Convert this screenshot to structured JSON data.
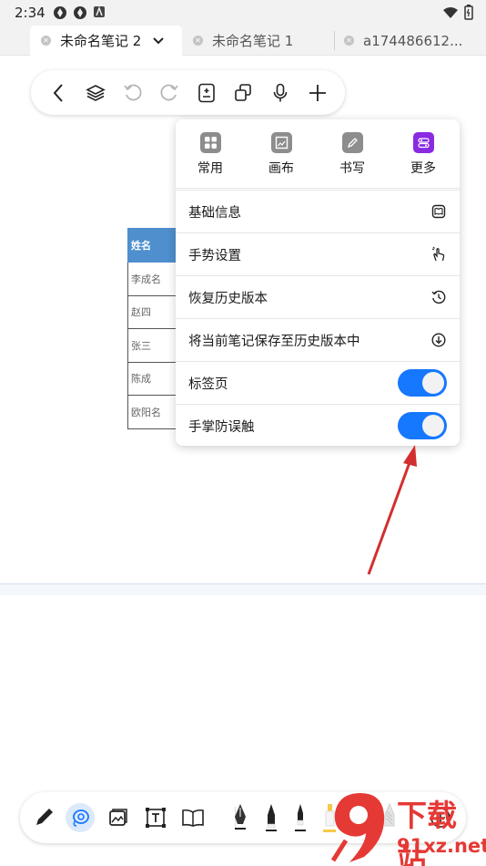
{
  "status_bar": {
    "time": "2:34"
  },
  "tabs": [
    {
      "label": "未命名笔记 2",
      "active": true
    },
    {
      "label": "未命名笔记 1",
      "active": false
    },
    {
      "label": "a174486612...",
      "active": false
    }
  ],
  "toolbar_icons": [
    "back-icon",
    "layers-icon",
    "undo-icon",
    "redo-icon",
    "page-add-icon",
    "copy-icon",
    "microphone-icon",
    "plus-icon"
  ],
  "table": {
    "header": "姓名",
    "rows": [
      "李成名",
      "赵四",
      "张三",
      "陈成",
      "欧阳名"
    ]
  },
  "menu": {
    "tabs": [
      {
        "label": "常用",
        "icon": "grid-icon"
      },
      {
        "label": "画布",
        "icon": "canvas-icon"
      },
      {
        "label": "书写",
        "icon": "pen-icon"
      },
      {
        "label": "更多",
        "icon": "more-settings-icon"
      }
    ],
    "items": [
      {
        "label": "基础信息",
        "icon": "book-icon"
      },
      {
        "label": "手势设置",
        "icon": "gesture-icon"
      },
      {
        "label": "恢复历史版本",
        "icon": "history-icon"
      },
      {
        "label": "将当前笔记保存至历史版本中",
        "icon": "download-circle-icon"
      },
      {
        "label": "标签页",
        "toggle": true
      },
      {
        "label": "手掌防误触",
        "toggle": true
      }
    ]
  },
  "colors": {
    "accent": "#1677ff",
    "arrow": "#d32f2f",
    "table_header": "#4f8fce",
    "more_icon": "#8a2be2"
  },
  "watermark": {
    "brand": "下载站",
    "site": "91xz.net"
  }
}
